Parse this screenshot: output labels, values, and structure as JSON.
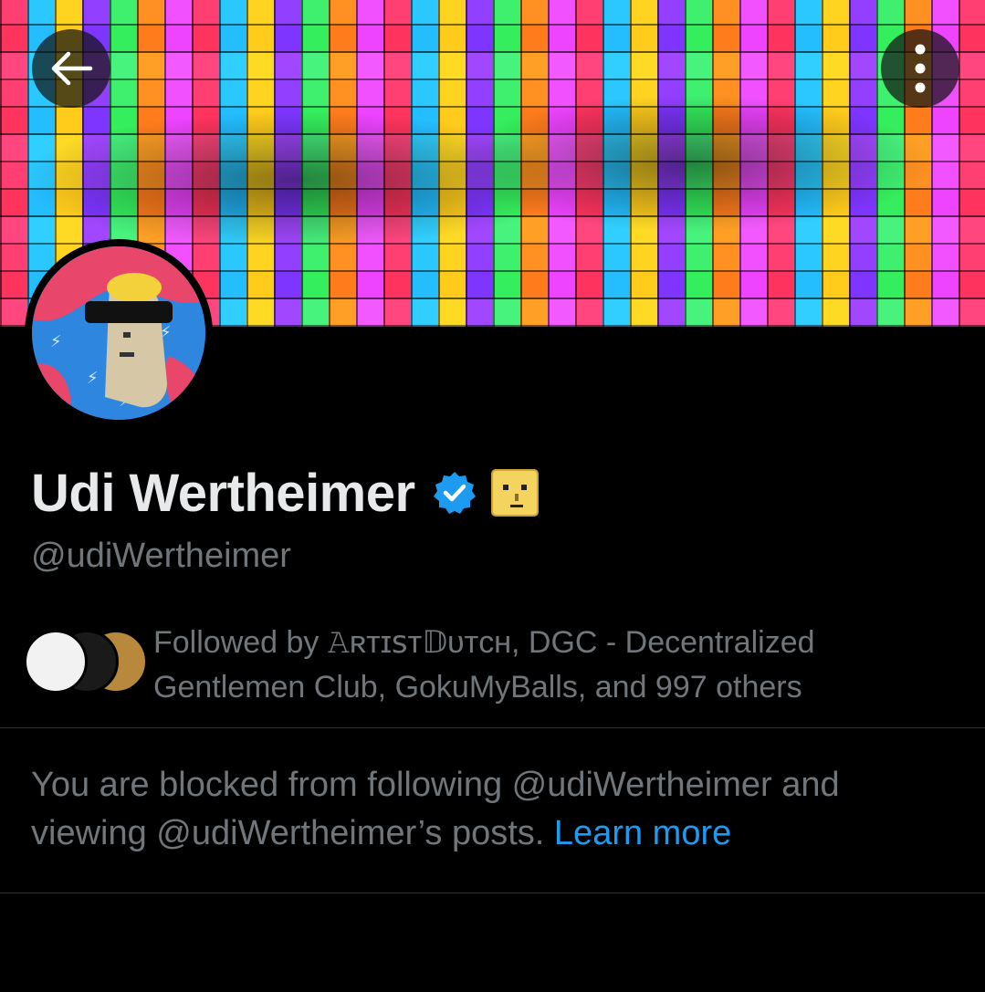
{
  "profile": {
    "display_name": "Udi Wertheimer",
    "handle": "@udiWertheimer",
    "verified": true,
    "badge_icon": "emoji-face-badge-icon"
  },
  "header": {
    "back_icon": "arrow-left-icon",
    "more_icon": "more-vertical-icon"
  },
  "followers": {
    "text": "Followed by 𝙰ʀᴛɪꜱᴛ𝔻ᴜᴛᴄʜ, DGC - Decentralized Gentlemen Club, GokuMyBalls, and 997 others"
  },
  "blocked_notice": {
    "text": "You are blocked from following @udiWertheimer and viewing @udiWertheimer’s posts.",
    "link_label": "Learn more"
  },
  "colors": {
    "background": "#000000",
    "primary_text": "#e7e9ea",
    "secondary_text": "#71767b",
    "link": "#1d9bf0",
    "verified": "#1d9bf0"
  }
}
